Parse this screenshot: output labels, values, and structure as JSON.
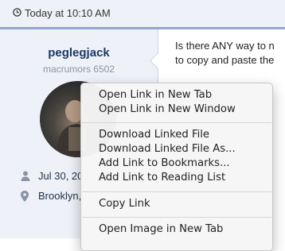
{
  "header": {
    "timestamp": "Today at 10:10 AM"
  },
  "user": {
    "name": "peglegjack",
    "title": "macrumors 6502",
    "joined": "Jul 30, 20",
    "location": "Brooklyn,"
  },
  "post": {
    "lines": [
      "Is there ANY way to n",
      "to copy and paste the"
    ]
  },
  "context_menu": {
    "items": [
      "Open Link in New Tab",
      "Open Link in New Window",
      "Download Linked File",
      "Download Linked File As...",
      "Add Link to Bookmarks...",
      "Add Link to Reading List",
      "Copy Link",
      "Open Image in New Tab"
    ]
  },
  "colors": {
    "header_bg": "#eef2f8",
    "accent_border": "#8fa9cf",
    "username": "#1c3863"
  },
  "icons": [
    "clock-icon",
    "user-icon",
    "location-pin-icon"
  ]
}
